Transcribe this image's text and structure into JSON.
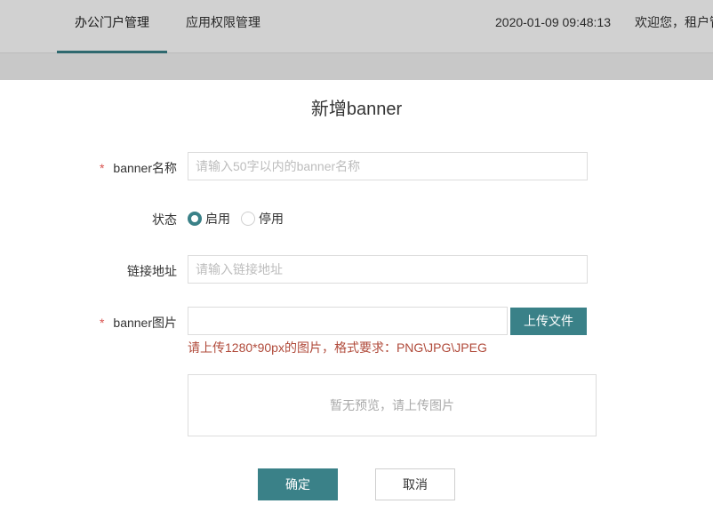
{
  "header": {
    "tabs": [
      {
        "label": "办公门户管理",
        "active": true
      },
      {
        "label": "应用权限管理",
        "active": false
      }
    ],
    "datetime": "2020-01-09 09:48:13",
    "welcome": "欢迎您，租户管"
  },
  "modal": {
    "title": "新增banner",
    "fields": {
      "name": {
        "label": "banner名称",
        "required": true,
        "placeholder": "请输入50字以内的banner名称"
      },
      "status": {
        "label": "状态",
        "options": [
          "启用",
          "停用"
        ],
        "selected": "启用"
      },
      "link": {
        "label": "链接地址",
        "placeholder": "请输入链接地址"
      },
      "image": {
        "label": "banner图片",
        "required": true,
        "upload_label": "上传文件",
        "hint": "请上传1280*90px的图片，格式要求：PNG\\JPG\\JPEG"
      }
    },
    "preview_text": "暂无预览，请上传图片",
    "required_mark": "*",
    "confirm_label": "确定",
    "cancel_label": "取消"
  },
  "colors": {
    "accent": "#3a8188",
    "required": "#d9534f",
    "hint": "#b04a3a"
  }
}
